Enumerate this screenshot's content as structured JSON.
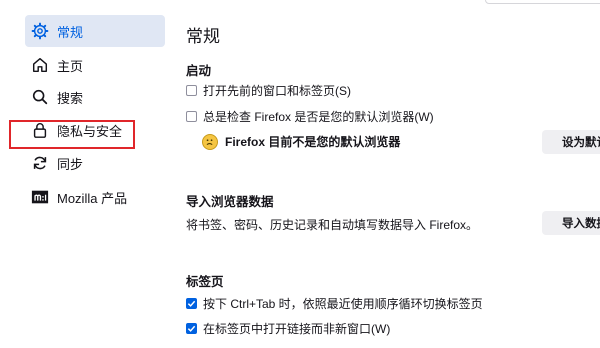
{
  "sidebar": {
    "items": [
      {
        "label": "常规",
        "icon": "gear-icon"
      },
      {
        "label": "主页",
        "icon": "home-icon"
      },
      {
        "label": "搜索",
        "icon": "search-icon"
      },
      {
        "label": "隐私与安全",
        "icon": "lock-icon"
      },
      {
        "label": "同步",
        "icon": "sync-icon"
      },
      {
        "label": "Mozilla 产品",
        "icon": "mozilla-icon"
      }
    ],
    "active_index": 0,
    "highlight_color": "#e0262a"
  },
  "main": {
    "title": "常规",
    "startup": {
      "heading": "启动",
      "restore_session": {
        "label": "打开先前的窗口和标签页(S)",
        "checked": false
      },
      "check_default": {
        "label": "总是检查 Firefox 是否是您的默认浏览器(W)",
        "checked": false
      },
      "default_status": "Firefox 目前不是您的默认浏览器",
      "set_default_button": "设为默认"
    },
    "import": {
      "heading": "导入浏览器数据",
      "description": "将书签、密码、历史记录和自动填写数据导入 Firefox。",
      "import_button": "导入数据"
    },
    "tabs": {
      "heading": "标签页",
      "ctrl_tab": {
        "label": "按下 Ctrl+Tab 时，依照最近使用顺序循环切换标签页",
        "checked": true
      },
      "open_links": {
        "label": "在标签页中打开链接而非新窗口(W)",
        "checked": true
      }
    }
  },
  "colors": {
    "accent": "#0061e0",
    "active_bg": "#e0e7f4"
  }
}
